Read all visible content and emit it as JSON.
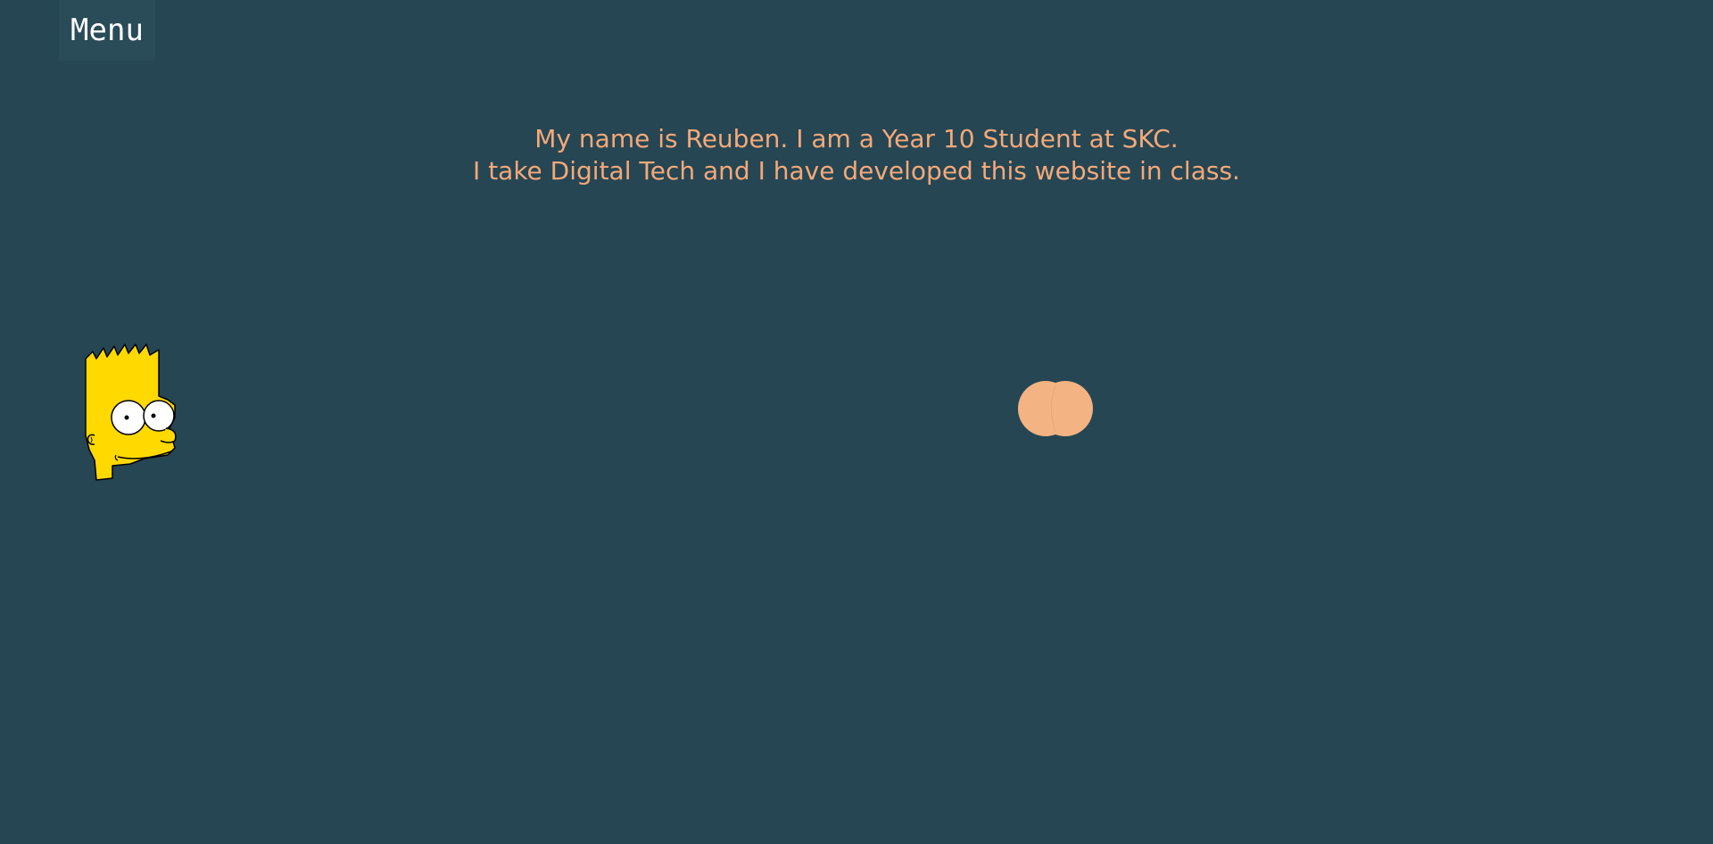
{
  "nav": {
    "menu_label": "Menu"
  },
  "intro": {
    "line1": "My name is Reuben. I am a Year 10 Student at SKC.",
    "line2": "I take Digital Tech and I have developed this website in class."
  },
  "colors": {
    "background": "#264653",
    "accent": "#f4a97a",
    "menu_bg": "#2a4b58",
    "menu_text": "#ffffff"
  },
  "icons": {
    "character": "bart-simpson-head-icon",
    "decoration": "peach-circles-icon"
  }
}
